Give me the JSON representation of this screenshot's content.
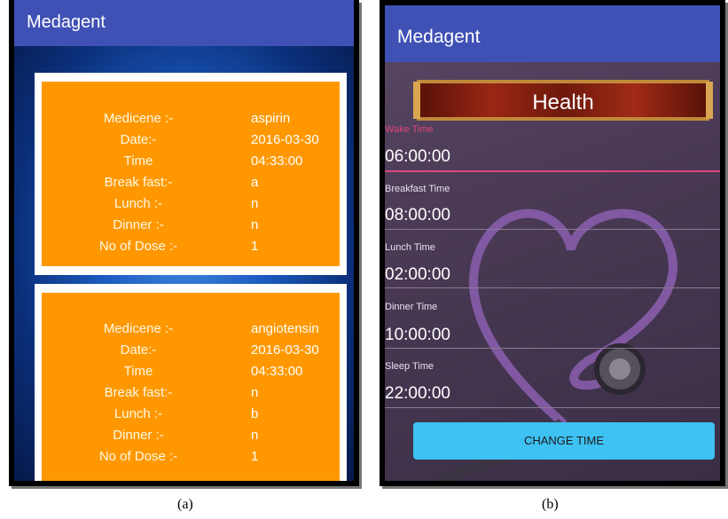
{
  "screen_a": {
    "app_title": "Medagent",
    "cards": [
      {
        "rows": [
          {
            "label": "Medicene :-",
            "value": "aspirin"
          },
          {
            "label": "Date:-",
            "value": "2016-03-30"
          },
          {
            "label": "Time",
            "value": "04:33:00"
          },
          {
            "label": "Break fast:-",
            "value": "a"
          },
          {
            "label": "Lunch :-",
            "value": "n"
          },
          {
            "label": "Dinner :-",
            "value": "n"
          },
          {
            "label": "No of Dose :-",
            "value": "1"
          }
        ]
      },
      {
        "rows": [
          {
            "label": "Medicene :-",
            "value": "angiotensin"
          },
          {
            "label": "Date:-",
            "value": "2016-03-30"
          },
          {
            "label": "Time",
            "value": "04:33:00"
          },
          {
            "label": "Break fast:-",
            "value": "n"
          },
          {
            "label": "Lunch :-",
            "value": "b"
          },
          {
            "label": "Dinner :-",
            "value": "n"
          },
          {
            "label": "No of Dose :-",
            "value": "1"
          }
        ]
      }
    ],
    "caption": "(a)"
  },
  "screen_b": {
    "app_title": "Medagent",
    "banner": "Health",
    "fields": [
      {
        "label": "Wake Time",
        "value": "06:00:00"
      },
      {
        "label": "Breakfast Time",
        "value": "08:00:00"
      },
      {
        "label": "Lunch Time",
        "value": "02:00:00"
      },
      {
        "label": "Dinner Time",
        "value": "10:00:00"
      },
      {
        "label": "Sleep Time",
        "value": "22:00:00"
      }
    ],
    "change_button": "CHANGE TIME",
    "caption": "(b)"
  },
  "colors": {
    "appbar": "#3f51b5",
    "card": "#ff9800",
    "button": "#3ec1f3",
    "active_underline": "#e0457a"
  }
}
